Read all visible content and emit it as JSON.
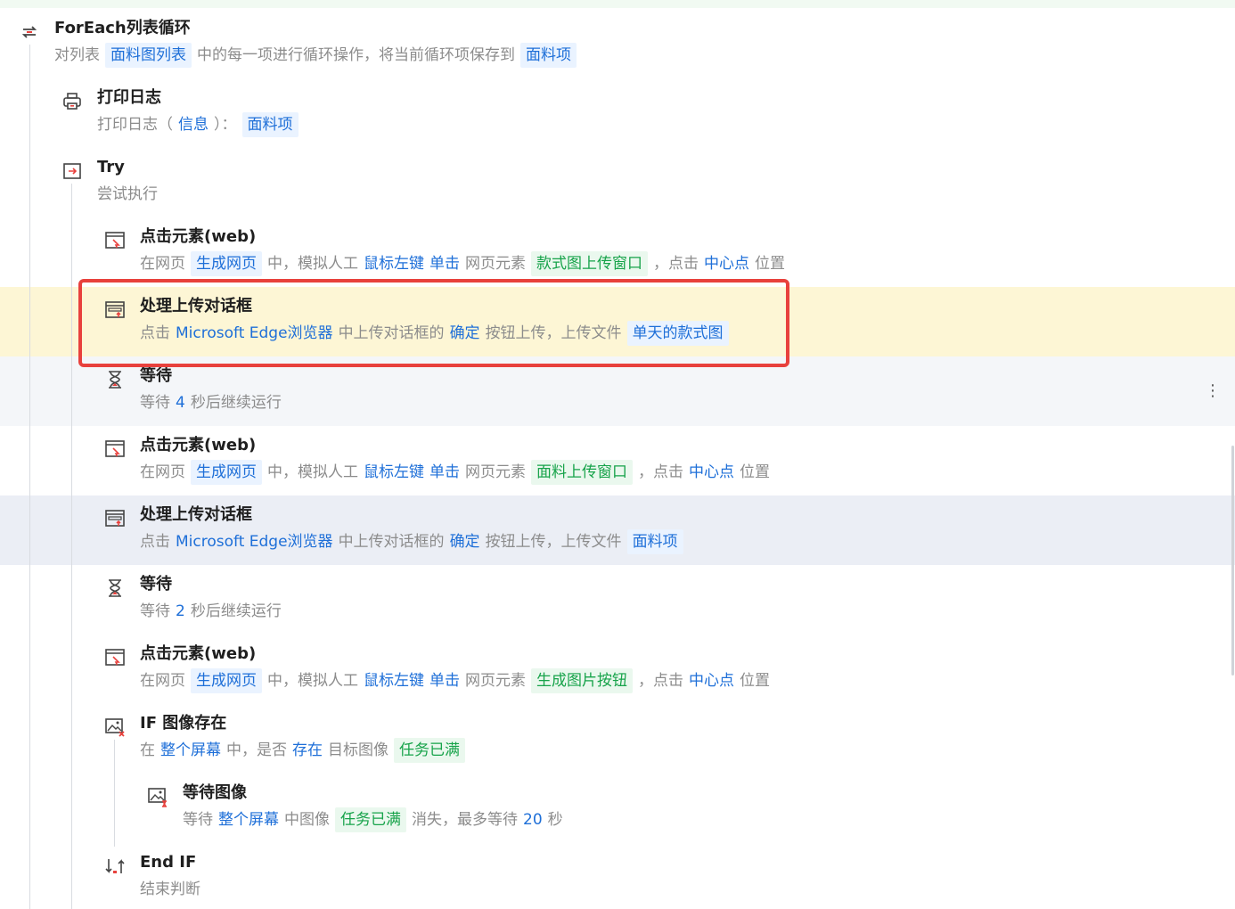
{
  "rows": [
    {
      "title": "ForEach列表循环",
      "desc": [
        {
          "t": "对列表",
          "c": "plain"
        },
        {
          "t": "面料图列表",
          "c": "chip-b"
        },
        {
          "t": "中的每一项进行循环操作，将当前循环项保存到",
          "c": "plain"
        },
        {
          "t": "面料项",
          "c": "chip-b"
        }
      ]
    },
    {
      "title": "打印日志",
      "desc": [
        {
          "t": "打印日志（",
          "c": "plain"
        },
        {
          "t": "信息",
          "c": "v"
        },
        {
          "t": "）：",
          "c": "plain"
        },
        {
          "t": "面料项",
          "c": "chip-b"
        }
      ]
    },
    {
      "title": "Try",
      "desc": [
        {
          "t": "尝试执行",
          "c": "plain"
        }
      ]
    },
    {
      "title": "点击元素(web)",
      "desc": [
        {
          "t": "在网页",
          "c": "plain"
        },
        {
          "t": "生成网页",
          "c": "chip-b"
        },
        {
          "t": "中，模拟人工",
          "c": "plain"
        },
        {
          "t": "鼠标左键",
          "c": "v"
        },
        {
          "t": "单击",
          "c": "v"
        },
        {
          "t": "网页元素",
          "c": "plain"
        },
        {
          "t": "款式图上传窗口",
          "c": "chip-g"
        },
        {
          "t": "，点击",
          "c": "plain"
        },
        {
          "t": "中心点",
          "c": "v"
        },
        {
          "t": "位置",
          "c": "plain"
        }
      ]
    },
    {
      "title": "处理上传对话框",
      "desc": [
        {
          "t": "点击",
          "c": "plain"
        },
        {
          "t": "Microsoft Edge浏览器",
          "c": "v"
        },
        {
          "t": "中上传对话框的",
          "c": "plain"
        },
        {
          "t": "确定",
          "c": "v"
        },
        {
          "t": "按钮上传，上传文件",
          "c": "plain"
        },
        {
          "t": "单天的款式图",
          "c": "chip-b"
        }
      ]
    },
    {
      "title": "等待",
      "desc": [
        {
          "t": "等待",
          "c": "plain"
        },
        {
          "t": "4",
          "c": "v"
        },
        {
          "t": "秒后继续运行",
          "c": "plain"
        }
      ]
    },
    {
      "title": "点击元素(web)",
      "desc": [
        {
          "t": "在网页",
          "c": "plain"
        },
        {
          "t": "生成网页",
          "c": "chip-b"
        },
        {
          "t": "中，模拟人工",
          "c": "plain"
        },
        {
          "t": "鼠标左键",
          "c": "v"
        },
        {
          "t": "单击",
          "c": "v"
        },
        {
          "t": "网页元素",
          "c": "plain"
        },
        {
          "t": "面料上传窗口",
          "c": "chip-g"
        },
        {
          "t": "，点击",
          "c": "plain"
        },
        {
          "t": "中心点",
          "c": "v"
        },
        {
          "t": "位置",
          "c": "plain"
        }
      ]
    },
    {
      "title": "处理上传对话框",
      "desc": [
        {
          "t": "点击",
          "c": "plain"
        },
        {
          "t": "Microsoft Edge浏览器",
          "c": "v"
        },
        {
          "t": "中上传对话框的",
          "c": "plain"
        },
        {
          "t": "确定",
          "c": "v"
        },
        {
          "t": "按钮上传，上传文件",
          "c": "plain"
        },
        {
          "t": "面料项",
          "c": "chip-b"
        }
      ]
    },
    {
      "title": "等待",
      "desc": [
        {
          "t": "等待",
          "c": "plain"
        },
        {
          "t": "2",
          "c": "v"
        },
        {
          "t": "秒后继续运行",
          "c": "plain"
        }
      ]
    },
    {
      "title": "点击元素(web)",
      "desc": [
        {
          "t": "在网页",
          "c": "plain"
        },
        {
          "t": "生成网页",
          "c": "chip-b"
        },
        {
          "t": "中，模拟人工",
          "c": "plain"
        },
        {
          "t": "鼠标左键",
          "c": "v"
        },
        {
          "t": "单击",
          "c": "v"
        },
        {
          "t": "网页元素",
          "c": "plain"
        },
        {
          "t": "生成图片按钮",
          "c": "chip-g"
        },
        {
          "t": "，点击",
          "c": "plain"
        },
        {
          "t": "中心点",
          "c": "v"
        },
        {
          "t": "位置",
          "c": "plain"
        }
      ]
    },
    {
      "title": "IF 图像存在",
      "desc": [
        {
          "t": "在",
          "c": "plain"
        },
        {
          "t": "整个屏幕",
          "c": "v"
        },
        {
          "t": "中，是否",
          "c": "plain"
        },
        {
          "t": "存在",
          "c": "v"
        },
        {
          "t": "目标图像",
          "c": "plain"
        },
        {
          "t": "任务已满",
          "c": "chip-g"
        }
      ]
    },
    {
      "title": "等待图像",
      "desc": [
        {
          "t": "等待",
          "c": "plain"
        },
        {
          "t": "整个屏幕",
          "c": "v"
        },
        {
          "t": "中图像",
          "c": "plain"
        },
        {
          "t": "任务已满",
          "c": "chip-g"
        },
        {
          "t": "消失，最多等待",
          "c": "plain"
        },
        {
          "t": "20",
          "c": "v"
        },
        {
          "t": "秒",
          "c": "plain"
        }
      ]
    },
    {
      "title": "End IF",
      "desc": [
        {
          "t": "结束判断",
          "c": "plain"
        }
      ]
    }
  ],
  "more_glyph": "⋮",
  "colors": {
    "accent": "#1e6fd8",
    "green": "#17a34a",
    "highlight_border": "#e8413d",
    "highlight_bg": "#fdf6d5"
  }
}
